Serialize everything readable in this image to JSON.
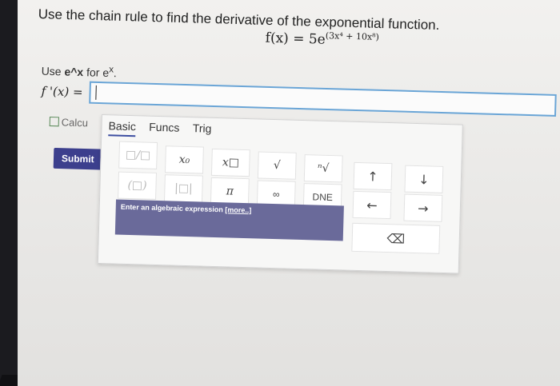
{
  "question": {
    "prompt": "Use the chain rule to find the derivative of the exponential function.",
    "formula_prefix": "f(x) = 5e",
    "formula_exponent": "(3x⁴ + 10x⁸)"
  },
  "hint": {
    "prefix": "Use ",
    "bold": "e^x",
    "suffix": " for e",
    "superscript": "x",
    "end": "."
  },
  "answer": {
    "label": "f '(x) =",
    "value": ""
  },
  "calculator": {
    "label": "Calcu"
  },
  "submit_label": "Submit",
  "palette": {
    "tabs": [
      "Basic",
      "Funcs",
      "Trig"
    ],
    "keys": {
      "fraction": "□/□",
      "x_sub": "x₀",
      "x_sup": "x□",
      "sqrt": "√",
      "nroot": "ⁿ√",
      "up": "↑",
      "down": "↓",
      "paren": "(□)",
      "abs": "|□|",
      "pi": "π",
      "inf": "∞",
      "dne": "DNE",
      "left": "←",
      "right": "→",
      "backspace": "⌫"
    },
    "expression_hint": "Enter an algebraic expression",
    "more_link": "[more..]"
  }
}
